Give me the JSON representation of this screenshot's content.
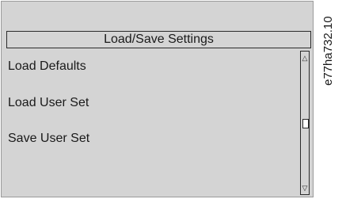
{
  "header": {
    "title": "Load/Save Settings"
  },
  "menu": {
    "items": [
      {
        "label": "Load Defaults"
      },
      {
        "label": "Load User Set"
      },
      {
        "label": "Save User Set"
      }
    ]
  },
  "scrollbar": {
    "up_glyph": "△",
    "down_glyph": "▽"
  },
  "figure": {
    "code": "e77ha732.10"
  },
  "colors": {
    "screen_bg": "#d4d4d4",
    "border": "#2a2a2a",
    "text": "#1a1a1a"
  }
}
